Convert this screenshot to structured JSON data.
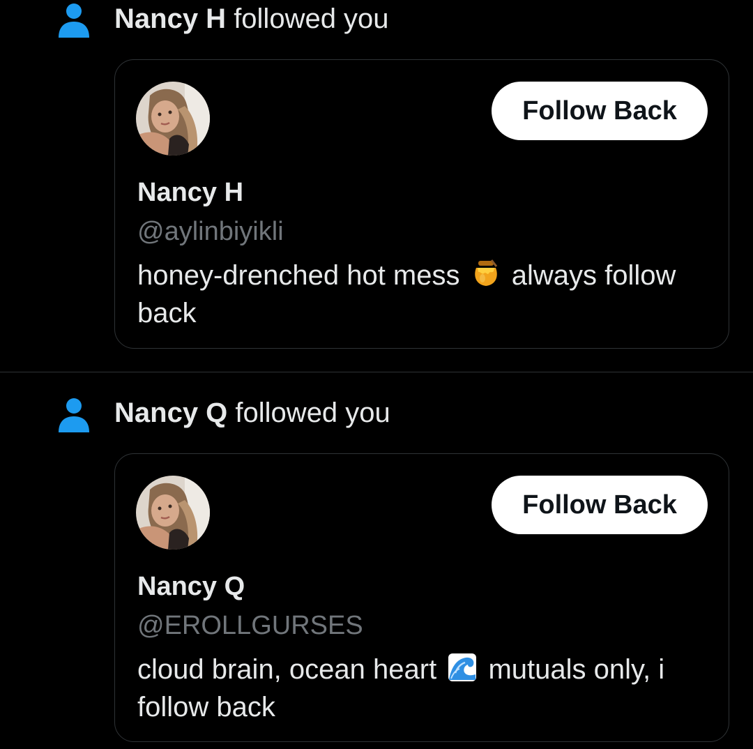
{
  "notifications": [
    {
      "follower_name": "Nancy H",
      "action_text": "followed you",
      "card": {
        "button_label": "Follow Back",
        "display_name": "Nancy H",
        "handle": "@aylinbiyikli",
        "bio_before_emoji": "honey-drenched hot mess",
        "bio_emoji": "honey-pot-emoji",
        "bio_after_emoji": "always follow",
        "bio_line2": "back"
      }
    },
    {
      "follower_name": "Nancy Q",
      "action_text": "followed you",
      "card": {
        "button_label": "Follow Back",
        "display_name": "Nancy Q",
        "handle": "@EROLLGURSES",
        "bio_before_emoji": "cloud brain, ocean heart",
        "bio_emoji": "water-wave-emoji",
        "bio_after_emoji": "mutuals only, i",
        "bio_line2": "follow back"
      }
    }
  ],
  "colors": {
    "background": "#000000",
    "accent_icon": "#1d9bf0",
    "button_bg": "#ffffff",
    "button_text": "#0f1419",
    "handle_text": "#71767b",
    "border": "#2f3336"
  }
}
